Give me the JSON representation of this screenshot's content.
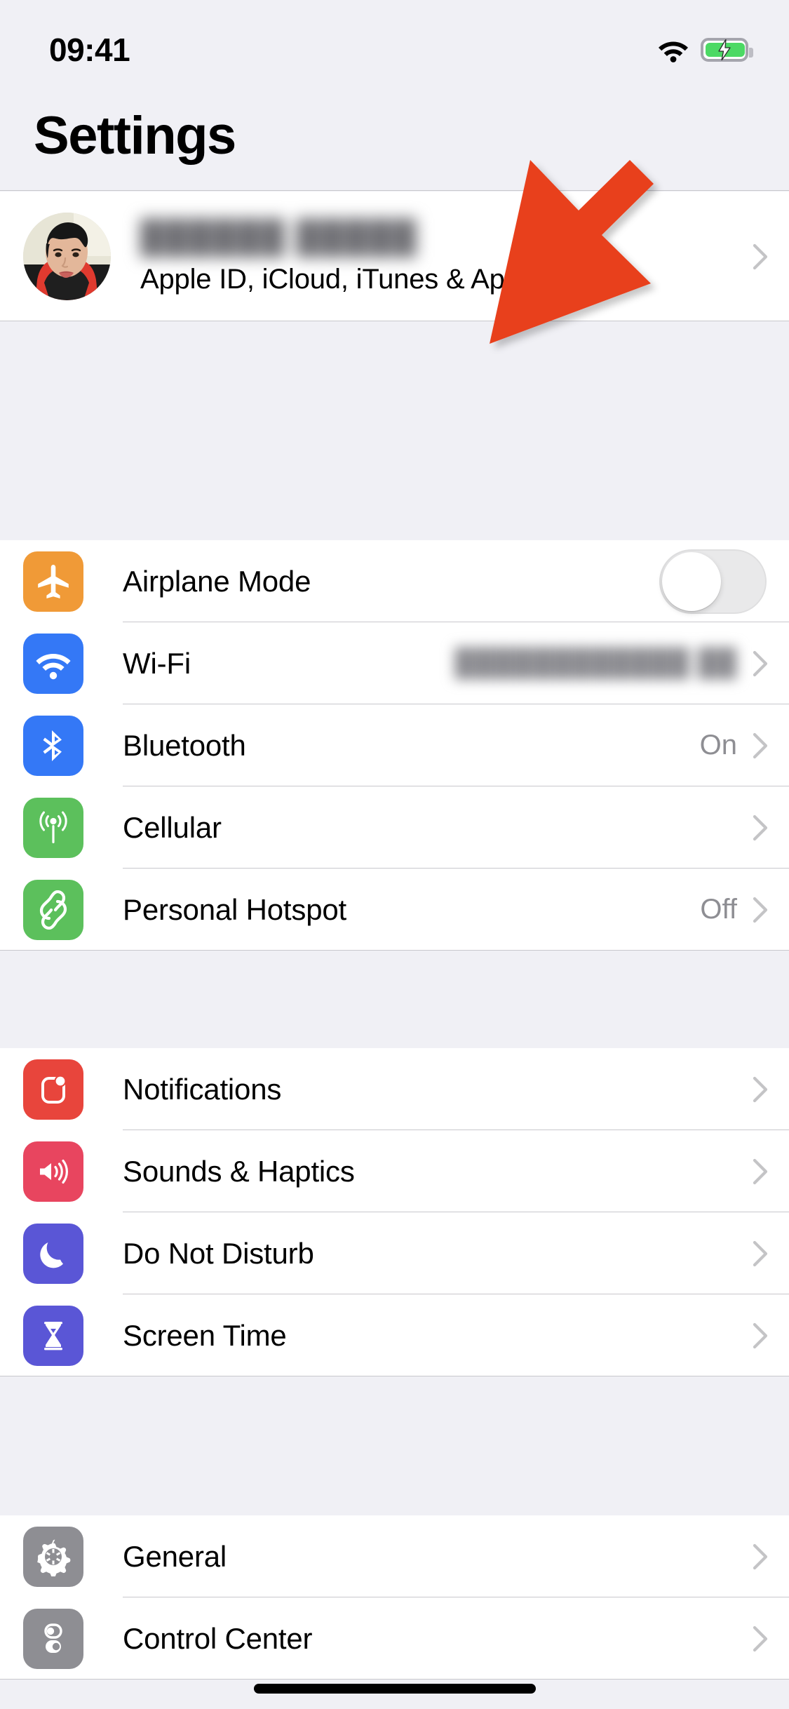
{
  "status_bar": {
    "time": "09:41",
    "wifi_icon": "wifi-icon",
    "battery_icon": "battery-charging-icon",
    "battery_state": "charging"
  },
  "header": {
    "title": "Settings"
  },
  "profile": {
    "name": "██████ █████",
    "subtitle": "Apple ID, iCloud, iTunes & App Store",
    "avatar_icon": "user-photo-avatar",
    "chevron": "chevron-right-icon"
  },
  "colors": {
    "background": "#f0f0f5",
    "row_background": "#ffffff",
    "separator": "#c8c7cc",
    "value_text": "#8e8e93",
    "annotation_arrow": "#e8401f",
    "airplane": "#f09a37",
    "wifi": "#3478f6",
    "bluetooth": "#3478f6",
    "cellular": "#5cc05c",
    "hotspot": "#5cc05c",
    "notifications": "#e8453c",
    "sounds": "#e8455f",
    "dnd": "#5a56d6",
    "screentime": "#5a56d6",
    "general": "#8e8e93",
    "control_center": "#8e8e93",
    "toggle_off_track": "#e9e9ea",
    "toggle_knob": "#ffffff"
  },
  "groups": [
    {
      "name": "connectivity",
      "rows": [
        {
          "label": "Airplane Mode",
          "icon": "airplane-icon",
          "icon_color": "#f09a37",
          "accessory": "toggle",
          "toggle_on": false,
          "value": ""
        },
        {
          "label": "Wi-Fi",
          "icon": "wifi-icon",
          "icon_color": "#3478f6",
          "accessory": "chevron",
          "value": "████████████ ██",
          "value_blurred": true
        },
        {
          "label": "Bluetooth",
          "icon": "bluetooth-icon",
          "icon_color": "#3478f6",
          "accessory": "chevron",
          "value": "On"
        },
        {
          "label": "Cellular",
          "icon": "cellular-antenna-icon",
          "icon_color": "#5cc05c",
          "accessory": "chevron",
          "value": ""
        },
        {
          "label": "Personal Hotspot",
          "icon": "hotspot-link-icon",
          "icon_color": "#5cc05c",
          "accessory": "chevron",
          "value": "Off"
        }
      ]
    },
    {
      "name": "notifications-sounds",
      "rows": [
        {
          "label": "Notifications",
          "icon": "notification-badge-icon",
          "icon_color": "#e8453c",
          "accessory": "chevron",
          "value": ""
        },
        {
          "label": "Sounds & Haptics",
          "icon": "speaker-waves-icon",
          "icon_color": "#e8455f",
          "accessory": "chevron",
          "value": ""
        },
        {
          "label": "Do Not Disturb",
          "icon": "moon-icon",
          "icon_color": "#5a56d6",
          "accessory": "chevron",
          "value": ""
        },
        {
          "label": "Screen Time",
          "icon": "hourglass-icon",
          "icon_color": "#5a56d6",
          "accessory": "chevron",
          "value": ""
        }
      ]
    },
    {
      "name": "system",
      "rows": [
        {
          "label": "General",
          "icon": "gear-icon",
          "icon_color": "#8e8e93",
          "accessory": "chevron",
          "value": ""
        },
        {
          "label": "Control Center",
          "icon": "control-center-toggles-icon",
          "icon_color": "#8e8e93",
          "accessory": "chevron",
          "value": ""
        }
      ]
    }
  ],
  "annotation": {
    "arrow_color": "#e8401f",
    "points_to": "profile-row"
  }
}
